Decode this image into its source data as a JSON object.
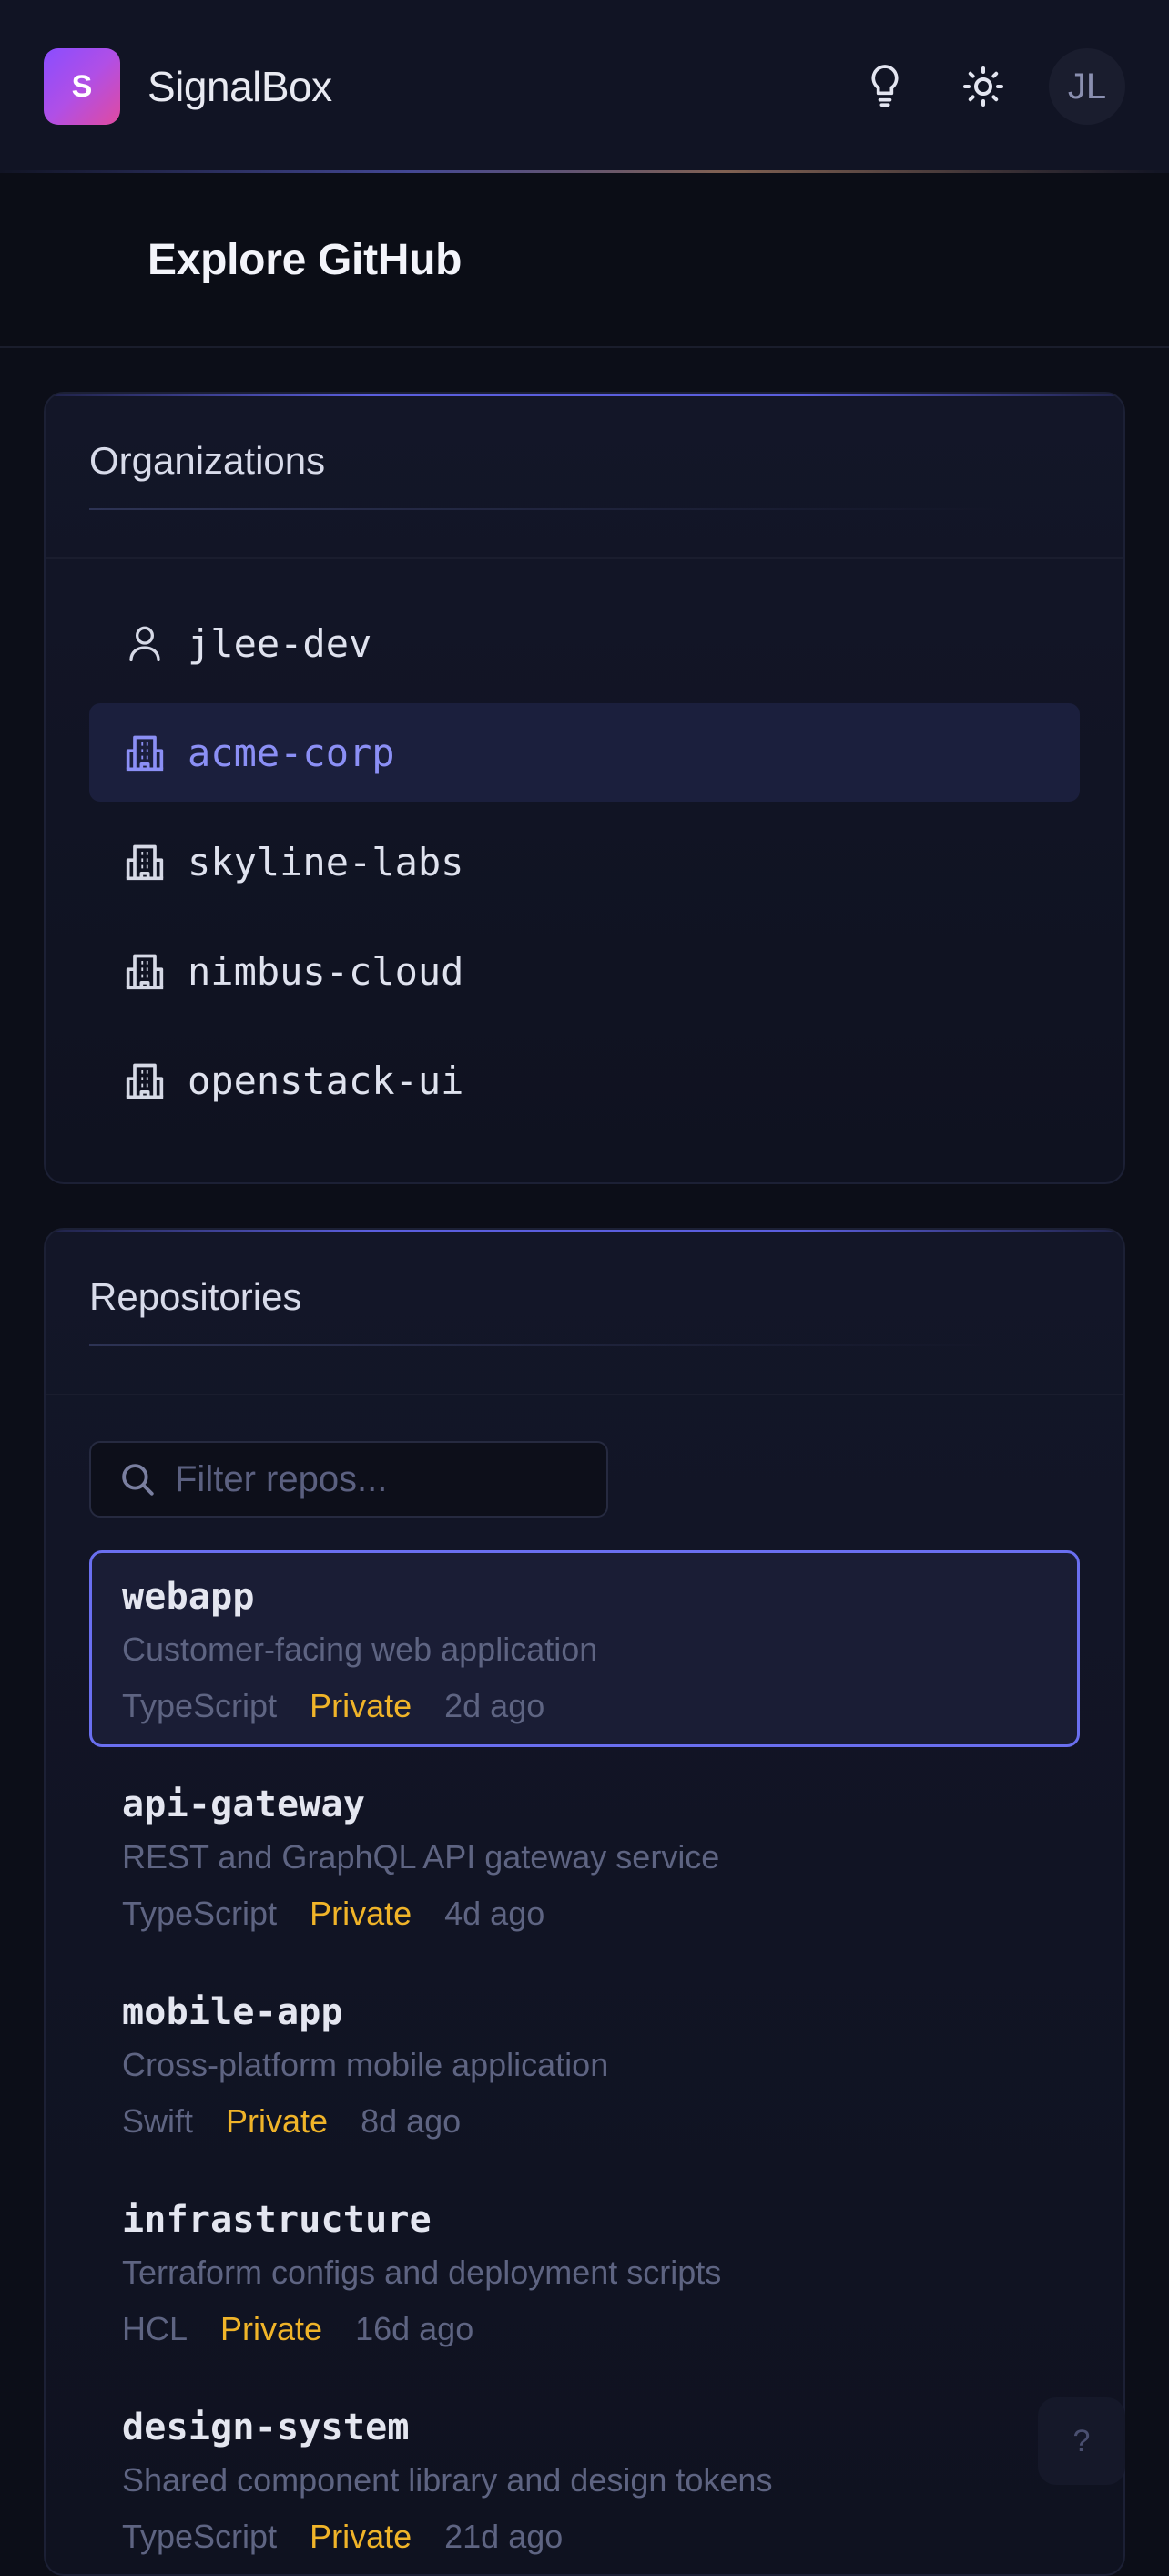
{
  "app": {
    "logo_letter": "S",
    "brand": "SignalBox",
    "avatar_initials": "JL"
  },
  "page": {
    "title": "Explore GitHub"
  },
  "organizations": {
    "title": "Organizations",
    "items": [
      {
        "name": "jlee-dev",
        "type": "user",
        "icon": "user-icon",
        "active": false
      },
      {
        "name": "acme-corp",
        "type": "org",
        "icon": "building-icon",
        "active": true
      },
      {
        "name": "skyline-labs",
        "type": "org",
        "icon": "building-icon",
        "active": false
      },
      {
        "name": "nimbus-cloud",
        "type": "org",
        "icon": "building-icon",
        "active": false
      },
      {
        "name": "openstack-ui",
        "type": "org",
        "icon": "building-icon",
        "active": false
      }
    ]
  },
  "repositories": {
    "title": "Repositories",
    "filter": {
      "placeholder": "Filter repos...",
      "value": ""
    },
    "items": [
      {
        "name": "webapp",
        "description": "Customer-facing web application",
        "language": "TypeScript",
        "visibility": "Private",
        "updated": "2d ago",
        "active": true
      },
      {
        "name": "api-gateway",
        "description": "REST and GraphQL API gateway service",
        "language": "TypeScript",
        "visibility": "Private",
        "updated": "4d ago",
        "active": false
      },
      {
        "name": "mobile-app",
        "description": "Cross-platform mobile application",
        "language": "Swift",
        "visibility": "Private",
        "updated": "8d ago",
        "active": false
      },
      {
        "name": "infrastructure",
        "description": "Terraform configs and deployment scripts",
        "language": "HCL",
        "visibility": "Private",
        "updated": "16d ago",
        "active": false
      },
      {
        "name": "design-system",
        "description": "Shared component library and design tokens",
        "language": "TypeScript",
        "visibility": "Private",
        "updated": "21d ago",
        "active": false
      }
    ]
  },
  "help": {
    "label": "?"
  },
  "colors": {
    "accent": "#6a6ff0",
    "private_badge": "#f0b429",
    "background": "#0c0e18"
  }
}
